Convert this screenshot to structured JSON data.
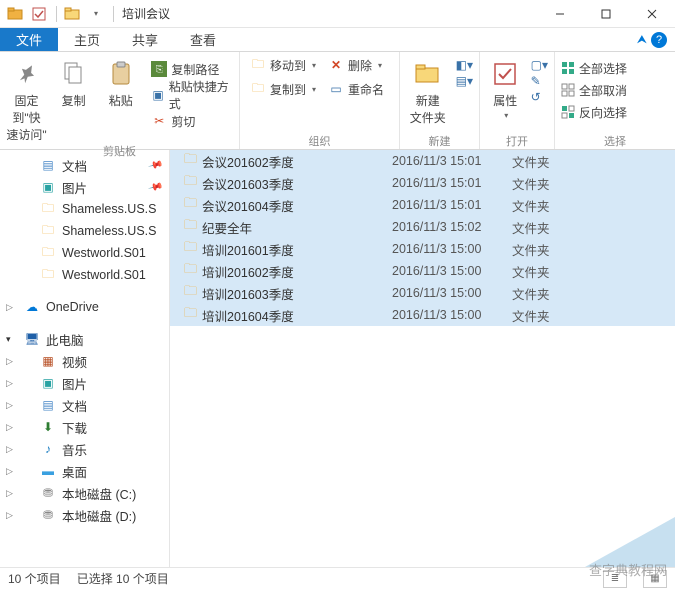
{
  "window": {
    "title": "培训会议"
  },
  "tabs": {
    "file": "文件",
    "home": "主页",
    "share": "共享",
    "view": "查看"
  },
  "ribbon": {
    "clipboard": {
      "pin": "固定到\"快\n速访问\"",
      "copy": "复制",
      "paste": "粘贴",
      "copypath": "复制路径",
      "shortcut": "粘贴快捷方式",
      "cut": "剪切",
      "label": "剪贴板"
    },
    "organize": {
      "moveto": "移动到",
      "copyto": "复制到",
      "delete": "删除",
      "rename": "重命名",
      "label": "组织"
    },
    "new": {
      "newfolder": "新建\n文件夹",
      "label": "新建"
    },
    "open": {
      "props": "属性",
      "label": "打开"
    },
    "select": {
      "all": "全部选择",
      "none": "全部取消",
      "invert": "反向选择",
      "label": "选择"
    }
  },
  "nav": {
    "docs": "文档",
    "pics": "图片",
    "f1": "Shameless.US.S",
    "f2": "Shameless.US.S",
    "f3": "Westworld.S01",
    "f4": "Westworld.S01",
    "onedrive": "OneDrive",
    "thispc": "此电脑",
    "video": "视频",
    "pics2": "图片",
    "docs2": "文档",
    "downloads": "下载",
    "music": "音乐",
    "desktop": "桌面",
    "cdrive": "本地磁盘 (C:)",
    "ddrive": "本地磁盘 (D:)"
  },
  "files": [
    {
      "name": "会议201602季度",
      "date": "2016/11/3 15:01",
      "type": "文件夹"
    },
    {
      "name": "会议201603季度",
      "date": "2016/11/3 15:01",
      "type": "文件夹"
    },
    {
      "name": "会议201604季度",
      "date": "2016/11/3 15:01",
      "type": "文件夹"
    },
    {
      "name": "纪要全年",
      "date": "2016/11/3 15:02",
      "type": "文件夹"
    },
    {
      "name": "培训201601季度",
      "date": "2016/11/3 15:00",
      "type": "文件夹"
    },
    {
      "name": "培训201602季度",
      "date": "2016/11/3 15:00",
      "type": "文件夹"
    },
    {
      "name": "培训201603季度",
      "date": "2016/11/3 15:00",
      "type": "文件夹"
    },
    {
      "name": "培训201604季度",
      "date": "2016/11/3 15:00",
      "type": "文件夹"
    }
  ],
  "status": {
    "count": "10 个项目",
    "selected": "已选择 10 个项目"
  },
  "watermark": "查字典教程网"
}
